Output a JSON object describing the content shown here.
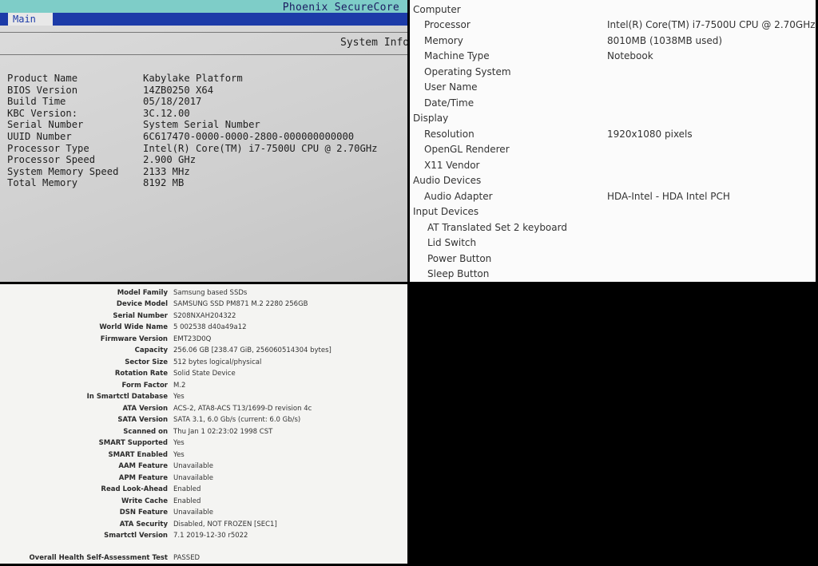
{
  "bios": {
    "brand": "Phoenix SecureCore",
    "tab": "Main",
    "section_title": "System Info",
    "rows": [
      {
        "label": "Product Name",
        "value": "Kabylake Platform"
      },
      {
        "label": "BIOS Version",
        "value": "14ZB0250 X64"
      },
      {
        "label": "Build Time",
        "value": "05/18/2017"
      },
      {
        "label": "KBC Version:",
        "value": "3C.12.00"
      },
      {
        "label": "Serial Number",
        "value": "System Serial Number"
      },
      {
        "label": "UUID Number",
        "value": "6C617470-0000-0000-2800-000000000000"
      },
      {
        "label": "Processor Type",
        "value": "Intel(R) Core(TM) i7-7500U CPU @ 2.70GHz"
      },
      {
        "label": "Processor Speed",
        "value": "2.900 GHz"
      },
      {
        "label": "System Memory Speed",
        "value": "2133 MHz"
      },
      {
        "label": "Total Memory",
        "value": "8192 MB"
      }
    ]
  },
  "hardware": {
    "lines": [
      {
        "label": "Computer",
        "value": "",
        "level": 0
      },
      {
        "label": "Processor",
        "value": "Intel(R) Core(TM) i7-7500U CPU @ 2.70GHz",
        "level": 1
      },
      {
        "label": "Memory",
        "value": "8010MB (1038MB used)",
        "level": 1
      },
      {
        "label": "Machine Type",
        "value": "Notebook",
        "level": 1
      },
      {
        "label": "Operating System",
        "value": "",
        "level": 1
      },
      {
        "label": "User Name",
        "value": "",
        "level": 1
      },
      {
        "label": "Date/Time",
        "value": "",
        "level": 1
      },
      {
        "label": "Display",
        "value": "",
        "level": 0
      },
      {
        "label": "Resolution",
        "value": "1920x1080 pixels",
        "level": 1
      },
      {
        "label": "OpenGL Renderer",
        "value": "",
        "level": 1
      },
      {
        "label": "X11 Vendor",
        "value": "",
        "level": 1
      },
      {
        "label": "Audio Devices",
        "value": "",
        "level": 0
      },
      {
        "label": "Audio Adapter",
        "value": "HDA-Intel - HDA Intel PCH",
        "level": 1
      },
      {
        "label": "Input Devices",
        "value": "",
        "level": 0
      },
      {
        "label": "AT Translated Set 2 keyboard",
        "value": "",
        "level": 2
      },
      {
        "label": "Lid Switch",
        "value": "",
        "level": 2
      },
      {
        "label": "Power Button",
        "value": "",
        "level": 2
      },
      {
        "label": "Sleep Button",
        "value": "",
        "level": 2
      }
    ]
  },
  "smart": {
    "rows": [
      {
        "label": "Model Family",
        "value": "Samsung based SSDs"
      },
      {
        "label": "Device Model",
        "value": "SAMSUNG SSD PM871 M.2 2280 256GB"
      },
      {
        "label": "Serial Number",
        "value": "S208NXAH204322"
      },
      {
        "label": "World Wide Name",
        "value": "5 002538 d40a49a12"
      },
      {
        "label": "Firmware Version",
        "value": "EMT23D0Q"
      },
      {
        "label": "Capacity",
        "value": "256.06 GB [238.47 GiB, 256060514304 bytes]"
      },
      {
        "label": "Sector Size",
        "value": "512 bytes logical/physical"
      },
      {
        "label": "Rotation Rate",
        "value": "Solid State Device"
      },
      {
        "label": "Form Factor",
        "value": "M.2"
      },
      {
        "label": "In Smartctl Database",
        "value": "Yes"
      },
      {
        "label": "ATA Version",
        "value": "ACS-2, ATA8-ACS T13/1699-D revision 4c"
      },
      {
        "label": "SATA Version",
        "value": "SATA 3.1, 6.0 Gb/s (current: 6.0 Gb/s)"
      },
      {
        "label": "Scanned on",
        "value": "Thu Jan  1 02:23:02 1998 CST"
      },
      {
        "label": "SMART Supported",
        "value": "Yes"
      },
      {
        "label": "SMART Enabled",
        "value": "Yes"
      },
      {
        "label": "AAM Feature",
        "value": "Unavailable"
      },
      {
        "label": "APM Feature",
        "value": "Unavailable"
      },
      {
        "label": "Read Look-Ahead",
        "value": "Enabled"
      },
      {
        "label": "Write Cache",
        "value": "Enabled"
      },
      {
        "label": "DSN Feature",
        "value": "Unavailable"
      },
      {
        "label": "ATA Security",
        "value": "Disabled, NOT FROZEN [SEC1]"
      },
      {
        "label": "Smartctl Version",
        "value": "7.1 2019-12-30 r5022"
      }
    ],
    "health": {
      "label": "Overall Health Self-Assessment Test",
      "value": "PASSED"
    }
  }
}
